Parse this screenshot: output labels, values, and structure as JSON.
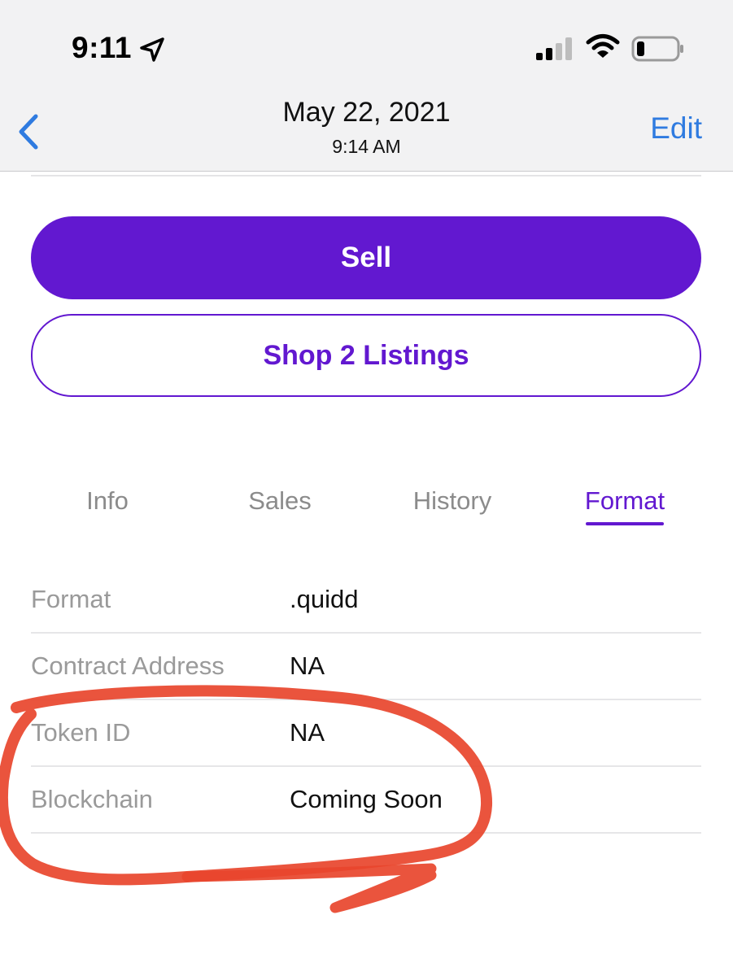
{
  "status_bar": {
    "time": "9:11",
    "icons": [
      "location-arrow-icon",
      "cellular-signal-icon",
      "wifi-icon",
      "battery-icon"
    ]
  },
  "nav": {
    "back_icon": "chevron-left-icon",
    "title": "May 22, 2021",
    "subtitle": "9:14 AM",
    "edit_label": "Edit"
  },
  "actions": {
    "sell_label": "Sell",
    "shop_label": "Shop 2 Listings"
  },
  "tabs": [
    {
      "label": "Info",
      "active": false
    },
    {
      "label": "Sales",
      "active": false
    },
    {
      "label": "History",
      "active": false
    },
    {
      "label": "Format",
      "active": true
    }
  ],
  "properties": [
    {
      "label": "Format",
      "value": ".quidd"
    },
    {
      "label": "Contract Address",
      "value": "NA"
    },
    {
      "label": "Token ID",
      "value": "NA"
    },
    {
      "label": "Blockchain",
      "value": "Coming Soon"
    }
  ],
  "colors": {
    "accent_purple": "#6218d0",
    "ios_blue": "#2f7be0",
    "annotation_red": "#e8452c",
    "label_gray": "#9a9a9a"
  }
}
